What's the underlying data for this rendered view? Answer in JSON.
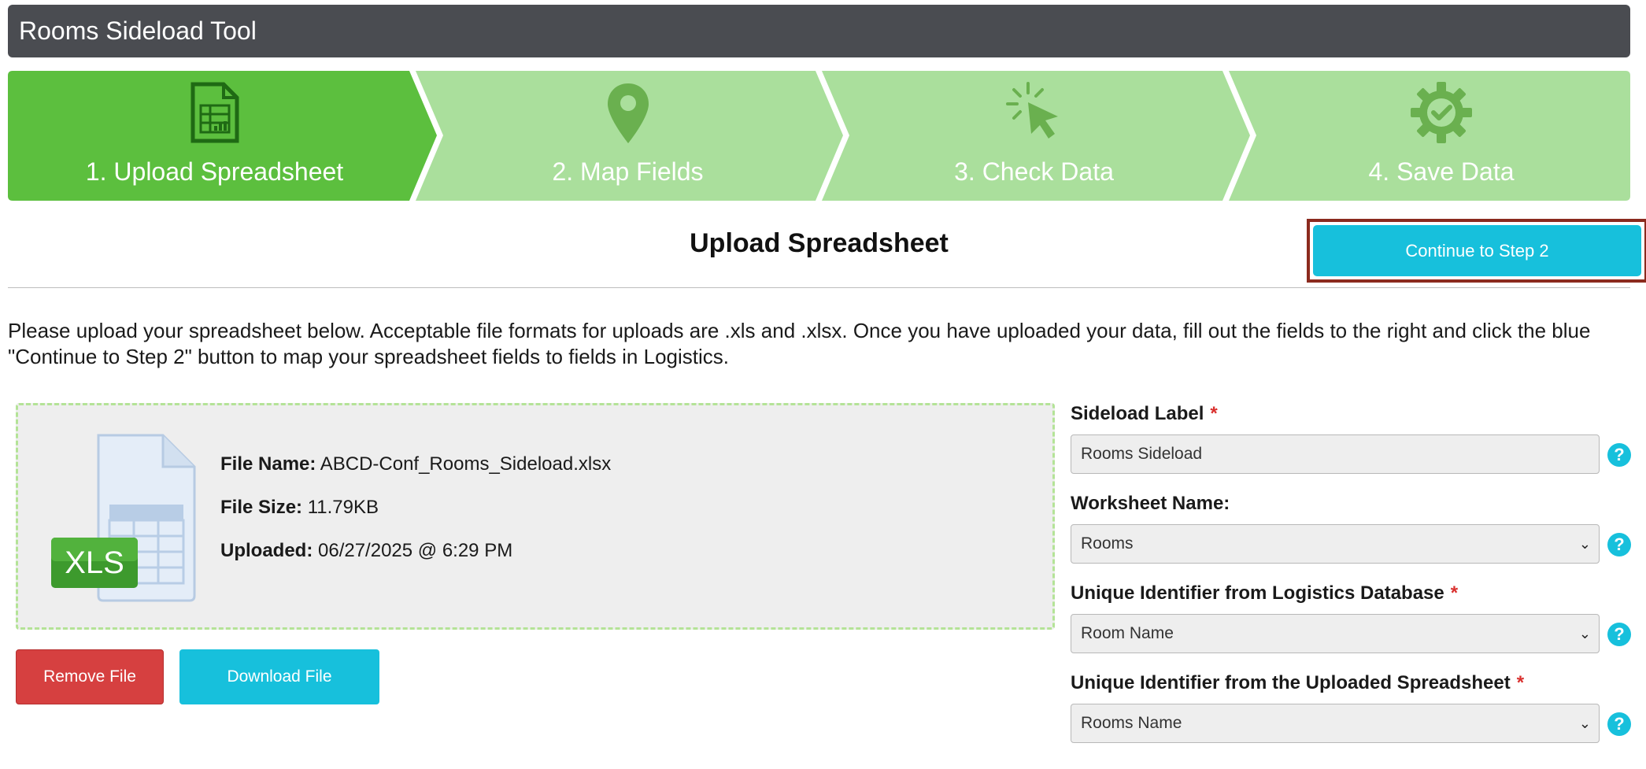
{
  "app": {
    "title": "Rooms Sideload Tool"
  },
  "wizard": {
    "steps": [
      {
        "label": "1. Upload Spreadsheet",
        "icon": "spreadsheet-icon",
        "active": true
      },
      {
        "label": "2. Map Fields",
        "icon": "map-pin-icon",
        "active": false
      },
      {
        "label": "3. Check Data",
        "icon": "cursor-click-icon",
        "active": false
      },
      {
        "label": "4. Save Data",
        "icon": "gear-check-icon",
        "active": false
      }
    ],
    "colors": {
      "active": "#5cbf3e",
      "inactive": "#aadf9c",
      "icon_active": "#1f6a14",
      "icon_inactive": "#6ab04f"
    }
  },
  "section": {
    "title": "Upload Spreadsheet",
    "continue_label": "Continue to Step 2"
  },
  "instructions": "Please upload your spreadsheet below. Acceptable file formats for uploads are .xls and .xlsx. Once you have uploaded your data, fill out the fields to the right and click the blue \"Continue to Step 2\" button to map your spreadsheet fields to fields in Logistics.",
  "file": {
    "icon_text": "XLS",
    "name_label": "File Name:",
    "name": "ABCD-Conf_Rooms_Sideload.xlsx",
    "size_label": "File Size:",
    "size": "11.79KB",
    "uploaded_label": "Uploaded:",
    "uploaded": "06/27/2025 @ 6:29 PM"
  },
  "buttons": {
    "remove": "Remove File",
    "download": "Download File"
  },
  "form": {
    "sideload_label": {
      "label": "Sideload Label",
      "required": "*",
      "value": "Rooms Sideload"
    },
    "worksheet": {
      "label": "Worksheet Name:",
      "value": "Rooms"
    },
    "unique_db": {
      "label": "Unique Identifier from Logistics Database",
      "required": "*",
      "value": "Room Name"
    },
    "unique_sheet": {
      "label": "Unique Identifier from the Uploaded Spreadsheet",
      "required": "*",
      "value": "Rooms Name"
    },
    "help_glyph": "?"
  }
}
